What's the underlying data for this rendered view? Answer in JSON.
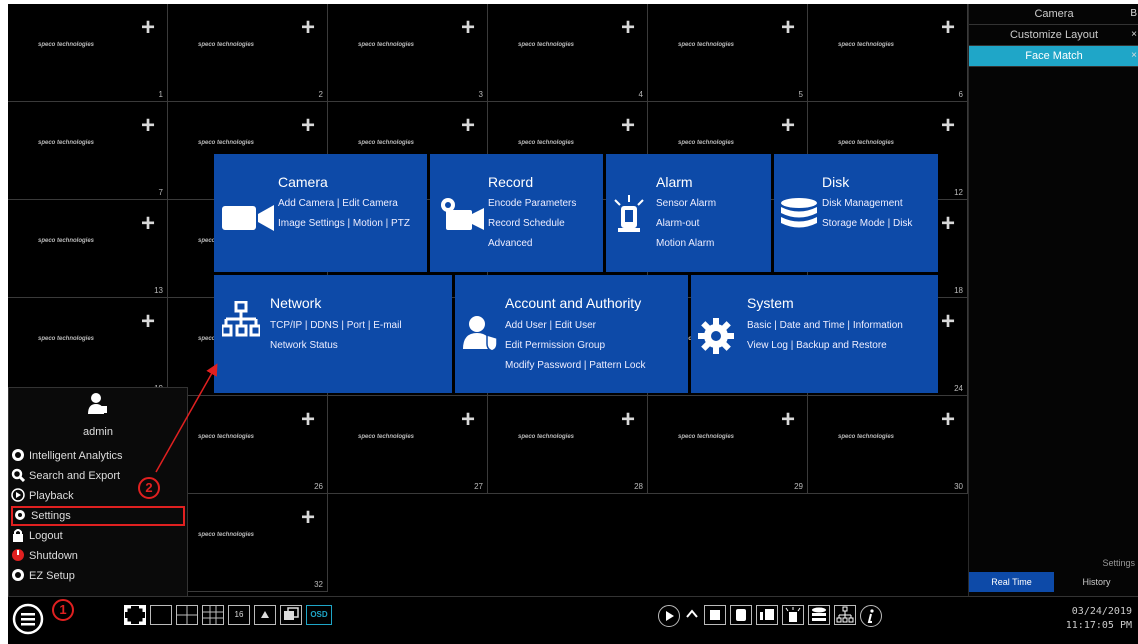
{
  "grid": {
    "logo_text": "speco technologies",
    "cells": [
      {
        "num": "1"
      },
      {
        "num": "2"
      },
      {
        "num": "3"
      },
      {
        "num": "4"
      },
      {
        "num": "5"
      },
      {
        "num": "6"
      },
      {
        "num": "7"
      },
      {
        "num": ""
      },
      {
        "num": ""
      },
      {
        "num": ""
      },
      {
        "num": ""
      },
      {
        "num": "12"
      },
      {
        "num": "13"
      },
      {
        "num": ""
      },
      {
        "num": ""
      },
      {
        "num": ""
      },
      {
        "num": ""
      },
      {
        "num": "18"
      },
      {
        "num": "19"
      },
      {
        "num": ""
      },
      {
        "num": ""
      },
      {
        "num": ""
      },
      {
        "num": ""
      },
      {
        "num": "24"
      },
      {
        "num": ""
      },
      {
        "num": "26"
      },
      {
        "num": "27"
      },
      {
        "num": "28"
      },
      {
        "num": "29"
      },
      {
        "num": "30"
      },
      {
        "num": ""
      },
      {
        "num": "32"
      }
    ]
  },
  "right_panel": {
    "items": [
      {
        "label": "Camera",
        "close": "B"
      },
      {
        "label": "Customize Layout",
        "close": "×"
      },
      {
        "label": "Face Match",
        "close": "×"
      }
    ],
    "settings_label": "Settings",
    "tabs": [
      "Real Time",
      "History"
    ]
  },
  "tiles": {
    "camera": {
      "title": "Camera",
      "l1a": "Add Camera",
      "l1b": "Edit Camera",
      "l2a": "Image Settings",
      "l2b": "Motion",
      "l2c": "PTZ"
    },
    "record": {
      "title": "Record",
      "l1": "Encode Parameters",
      "l2": "Record Schedule",
      "l3": "Advanced"
    },
    "alarm": {
      "title": "Alarm",
      "l1": "Sensor Alarm",
      "l2": "Alarm-out",
      "l3": "Motion Alarm"
    },
    "disk": {
      "title": "Disk",
      "l1": "Disk Management",
      "l2a": "Storage Mode",
      "l2b": "Disk"
    },
    "network": {
      "title": "Network",
      "l1a": "TCP/IP",
      "l1b": "DDNS",
      "l1c": "Port",
      "l1d": "E-mail",
      "l2": "Network Status"
    },
    "account": {
      "title": "Account and Authority",
      "l1a": "Add User",
      "l1b": "Edit User",
      "l2": "Edit Permission Group",
      "l3a": "Modify Password",
      "l3b": "Pattern Lock"
    },
    "system": {
      "title": "System",
      "l1a": "Basic",
      "l1b": "Date and Time",
      "l1c": "Information",
      "l2a": "View Log",
      "l2b": "Backup and Restore"
    }
  },
  "start_menu": {
    "username": "admin",
    "items": [
      "Intelligent Analytics",
      "Search and Export",
      "Playback",
      "Settings",
      "Logout",
      "Shutdown",
      "EZ Setup"
    ]
  },
  "annotations": {
    "badge1": "1",
    "badge2": "2"
  },
  "taskbar": {
    "osd_label": "OSD",
    "layout_16": "16",
    "date": "03/24/2019",
    "time": "11:17:05 PM"
  },
  "colors": {
    "tile_blue": "#0d4aa8",
    "face_match_cyan": "#1fa6c8",
    "annotation_red": "#e02020"
  }
}
